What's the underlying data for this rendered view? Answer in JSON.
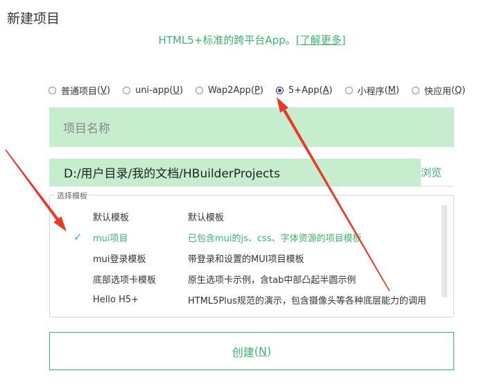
{
  "title": "新建项目",
  "subtitle": {
    "text": "HTML5+标准的跨平台App。",
    "link": "[了解更多]"
  },
  "project_types": [
    {
      "label": "普通项目",
      "mnemonic": "V",
      "selected": false
    },
    {
      "label": "uni-app",
      "mnemonic": "U",
      "selected": false
    },
    {
      "label": "Wap2App",
      "mnemonic": "P",
      "selected": false
    },
    {
      "label": "5+App",
      "mnemonic": "A",
      "selected": true
    },
    {
      "label": "小程序",
      "mnemonic": "M",
      "selected": false
    },
    {
      "label": "快应用",
      "mnemonic": "Q",
      "selected": false
    }
  ],
  "project_name": {
    "placeholder": "项目名称",
    "value": ""
  },
  "project_path": {
    "value": "D:/用户目录/我的文档/HBuilderProjects"
  },
  "browse_label": "浏览",
  "template_group": {
    "legend": "选择模板",
    "items": [
      {
        "name": "默认模板",
        "desc": "默认模板",
        "selected": false
      },
      {
        "name": "mui项目",
        "desc": "已包含mui的js、css、字体资源的项目模板",
        "selected": true
      },
      {
        "name": "mui登录模板",
        "desc": "带登录和设置的MUI项目模板",
        "selected": false
      },
      {
        "name": "底部选项卡模板",
        "desc": "原生选项卡示例，含tab中部凸起半圆示例",
        "selected": false
      },
      {
        "name": "Hello H5+",
        "desc": "HTML5Plus规范的演示，包含摄像头等各种底层能力的调用",
        "selected": false
      }
    ],
    "check_glyph": "✓"
  },
  "create_button": {
    "label": "创建",
    "mnemonic": "N"
  },
  "colors": {
    "accent": "#3cb371",
    "field_bg": "#c6edcd",
    "annotation": "#e8392a"
  }
}
